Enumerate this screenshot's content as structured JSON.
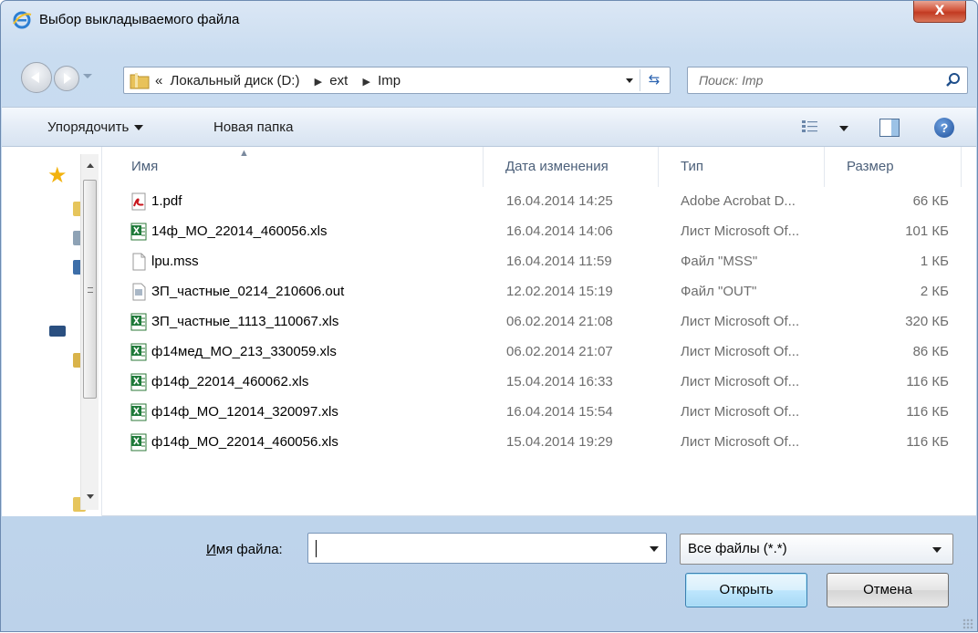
{
  "window": {
    "title": "Выбор выкладываемого файла",
    "close_label": "X"
  },
  "address": {
    "prefix": "«",
    "crumbs": [
      "Локальный диск (D:)",
      "ext",
      "Imp"
    ],
    "search_placeholder": "Поиск: Imp"
  },
  "toolbar": {
    "organize_label": "Упорядочить",
    "new_folder_label": "Новая папка",
    "help_label": "?"
  },
  "columns": {
    "name": "Имя",
    "date": "Дата изменения",
    "type": "Тип",
    "size": "Размер"
  },
  "files": [
    {
      "name": "1.pdf",
      "date": "16.04.2014 14:25",
      "type": "Adobe Acrobat D...",
      "size": "66 КБ",
      "icon": "pdf-icon"
    },
    {
      "name": "14ф_МО_22014_460056.xls",
      "date": "16.04.2014 14:06",
      "type": "Лист Microsoft Of...",
      "size": "101 КБ",
      "icon": "excel-icon"
    },
    {
      "name": "lpu.mss",
      "date": "16.04.2014 11:59",
      "type": "Файл \"MSS\"",
      "size": "1 КБ",
      "icon": "blank-file-icon"
    },
    {
      "name": "ЗП_частные_0214_210606.out",
      "date": "12.02.2014 15:19",
      "type": "Файл \"OUT\"",
      "size": "2 КБ",
      "icon": "generic-file-icon"
    },
    {
      "name": "ЗП_частные_1113_110067.xls",
      "date": "06.02.2014 21:08",
      "type": "Лист Microsoft Of...",
      "size": "320 КБ",
      "icon": "excel-icon"
    },
    {
      "name": "ф14мед_МО_213_330059.xls",
      "date": "06.02.2014 21:07",
      "type": "Лист Microsoft Of...",
      "size": "86 КБ",
      "icon": "excel-icon"
    },
    {
      "name": "ф14ф_22014_460062.xls",
      "date": "15.04.2014 16:33",
      "type": "Лист Microsoft Of...",
      "size": "116 КБ",
      "icon": "excel-icon"
    },
    {
      "name": "ф14ф_МО_12014_320097.xls",
      "date": "16.04.2014 15:54",
      "type": "Лист Microsoft Of...",
      "size": "116 КБ",
      "icon": "excel-icon"
    },
    {
      "name": "ф14ф_МО_22014_460056.xls",
      "date": "15.04.2014 19:29",
      "type": "Лист Microsoft Of...",
      "size": "116 КБ",
      "icon": "excel-icon"
    }
  ],
  "bottom": {
    "filename_label_u": "И",
    "filename_label_rest": "мя файла:",
    "filename_value": "",
    "filter_value": "Все файлы (*.*)",
    "open_label": "Открыть",
    "cancel_label": "Отмена"
  },
  "colors": {
    "accent": "#3c7fb1",
    "title_bar": "#c9dcf0",
    "close": "#c23a22"
  }
}
